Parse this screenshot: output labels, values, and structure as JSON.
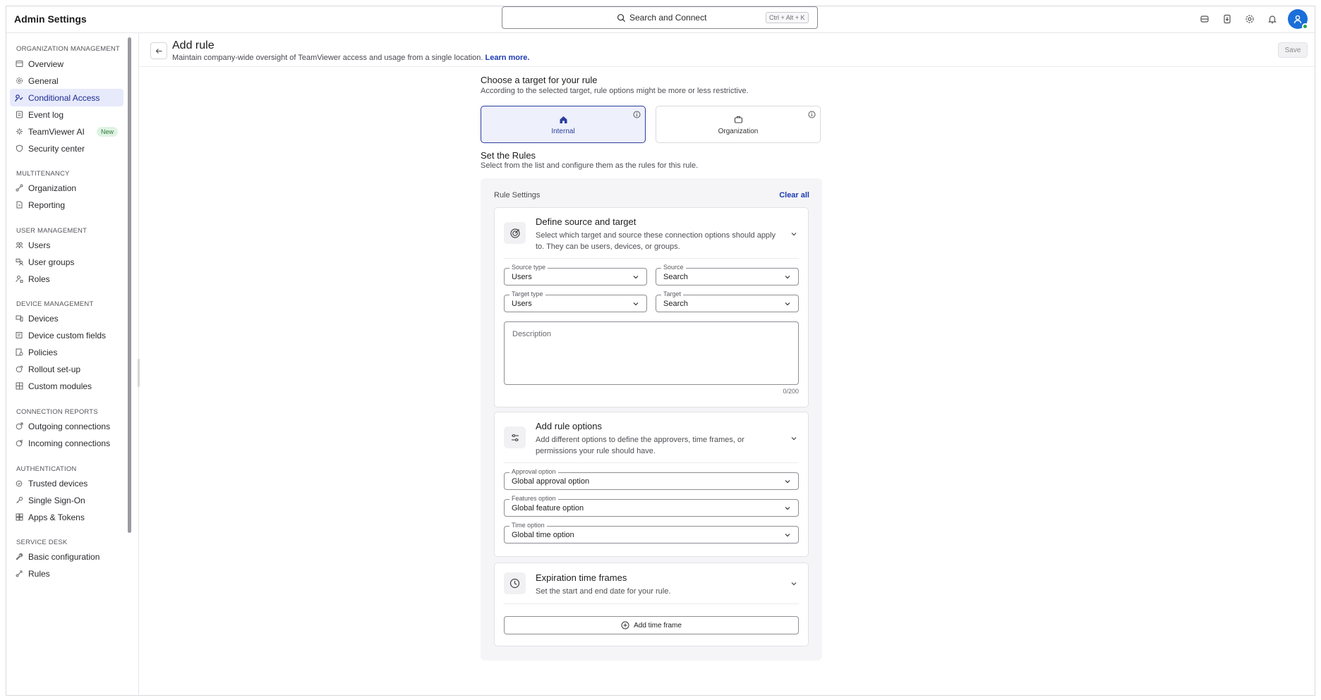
{
  "app": {
    "title": "Admin Settings"
  },
  "search": {
    "placeholder": "Search and Connect",
    "shortcut": "Ctrl + Alt + K"
  },
  "topbar_icons": [
    "remote-device-icon",
    "download-icon",
    "settings-gear-icon",
    "notification-bell-icon",
    "user-avatar-icon"
  ],
  "sidebar": {
    "sections": [
      {
        "title": "ORGANIZATION MANAGEMENT",
        "items": [
          {
            "label": "Overview",
            "icon": "overview-icon"
          },
          {
            "label": "General",
            "icon": "gear-icon"
          },
          {
            "label": "Conditional Access",
            "icon": "conditional-access-icon",
            "active": true
          },
          {
            "label": "Event log",
            "icon": "event-log-icon"
          },
          {
            "label": "TeamViewer AI",
            "icon": "ai-sparkle-icon",
            "badge": "New"
          },
          {
            "label": "Security center",
            "icon": "shield-icon"
          }
        ]
      },
      {
        "title": "MULTITENANCY",
        "items": [
          {
            "label": "Organization",
            "icon": "organization-icon"
          },
          {
            "label": "Reporting",
            "icon": "report-icon"
          }
        ]
      },
      {
        "title": "USER MANAGEMENT",
        "items": [
          {
            "label": "Users",
            "icon": "users-icon"
          },
          {
            "label": "User groups",
            "icon": "user-groups-icon"
          },
          {
            "label": "Roles",
            "icon": "roles-icon"
          }
        ]
      },
      {
        "title": "DEVICE MANAGEMENT",
        "items": [
          {
            "label": "Devices",
            "icon": "devices-icon"
          },
          {
            "label": "Device custom fields",
            "icon": "custom-fields-icon"
          },
          {
            "label": "Policies",
            "icon": "policies-icon"
          },
          {
            "label": "Rollout set-up",
            "icon": "rollout-icon"
          },
          {
            "label": "Custom modules",
            "icon": "modules-icon"
          }
        ]
      },
      {
        "title": "CONNECTION REPORTS",
        "items": [
          {
            "label": "Outgoing connections",
            "icon": "outgoing-icon"
          },
          {
            "label": "Incoming connections",
            "icon": "incoming-icon"
          }
        ]
      },
      {
        "title": "AUTHENTICATION",
        "items": [
          {
            "label": "Trusted devices",
            "icon": "trusted-devices-icon"
          },
          {
            "label": "Single Sign-On",
            "icon": "key-icon"
          },
          {
            "label": "Apps & Tokens",
            "icon": "apps-icon"
          }
        ]
      },
      {
        "title": "SERVICE DESK",
        "items": [
          {
            "label": "Basic configuration",
            "icon": "wrench-icon"
          },
          {
            "label": "Rules",
            "icon": "rules-icon"
          }
        ]
      }
    ]
  },
  "header": {
    "title": "Add rule",
    "subtitle": "Maintain company-wide oversight of TeamViewer access and usage from a single location.",
    "learn_more": "Learn more.",
    "save_label": "Save"
  },
  "target": {
    "heading": "Choose a target for your rule",
    "subheading": "According to the selected target, rule options might be more or less restrictive.",
    "options": [
      {
        "label": "Internal",
        "icon": "home-icon",
        "selected": true
      },
      {
        "label": "Organization",
        "icon": "briefcase-icon",
        "selected": false
      }
    ]
  },
  "rules": {
    "heading": "Set the Rules",
    "subheading": "Select from the list and configure them as the rules for this rule.",
    "panel_title": "Rule Settings",
    "clear_all": "Clear all",
    "source_target": {
      "title": "Define source and target",
      "description": "Select which target and source these connection options should apply to. They can be users, devices, or groups.",
      "source_type": {
        "label": "Source type",
        "value": "Users"
      },
      "source": {
        "label": "Source",
        "value": "Search"
      },
      "target_type": {
        "label": "Target type",
        "value": "Users"
      },
      "target": {
        "label": "Target",
        "value": "Search"
      },
      "description_placeholder": "Description",
      "counter": "0/200"
    },
    "rule_options": {
      "title": "Add rule options",
      "description": "Add different options to define the approvers, time frames, or permissions your rule should have.",
      "approval": {
        "label": "Approval option",
        "value": "Global approval option"
      },
      "features": {
        "label": "Features option",
        "value": "Global feature option"
      },
      "time": {
        "label": "Time option",
        "value": "Global time option"
      }
    },
    "expiration": {
      "title": "Expiration time frames",
      "description": "Set the start and end date for your rule.",
      "add_label": "Add time frame"
    }
  }
}
